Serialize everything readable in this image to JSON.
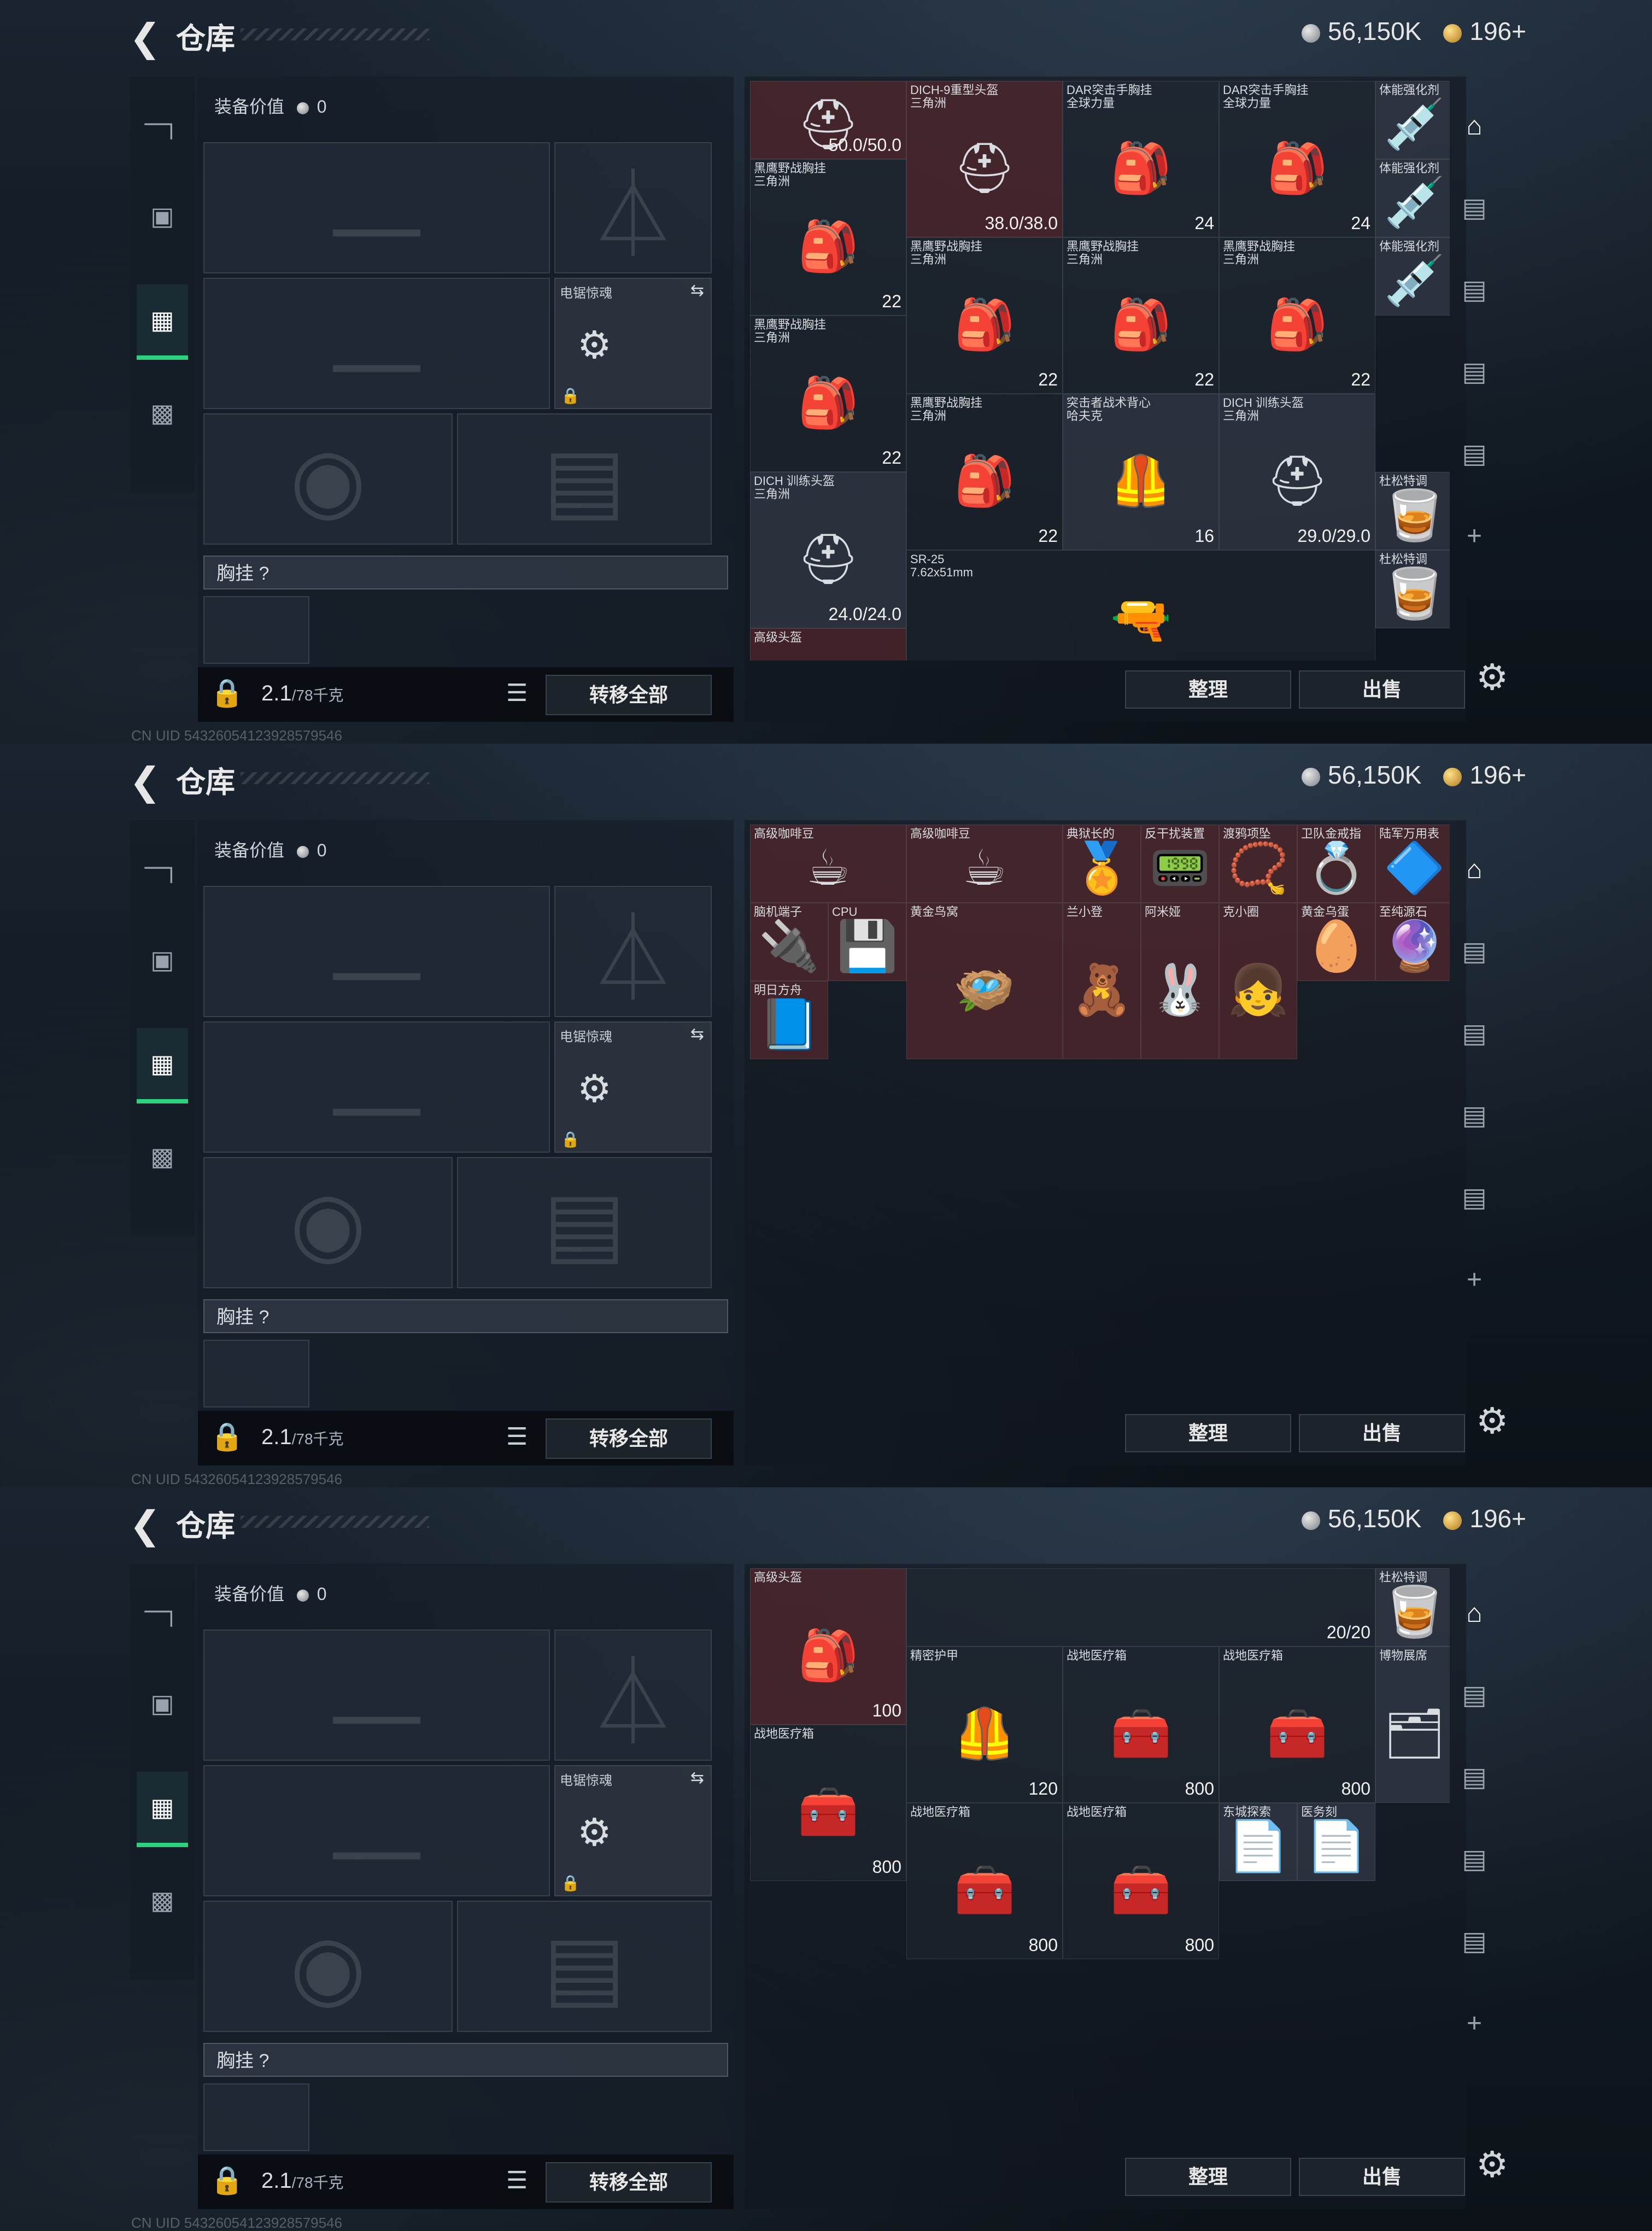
{
  "header": {
    "title": "仓库",
    "silver_amount": "56,150K",
    "gold_amount": "196+"
  },
  "equip": {
    "value_label": "装备价值",
    "value": "0",
    "melee_label": "电锯惊魂",
    "chest_label": "胸挂 ?",
    "weight": "2.1",
    "weight_max": "/78千克",
    "transfer_all": "转移全部"
  },
  "actions": {
    "sort": "整理",
    "sell": "出售"
  },
  "footer": "CN UID 5432605412392857954​6",
  "frames": [
    {
      "cells": [
        {
          "name": "",
          "count": "50.0/50.0",
          "style": "red",
          "icon": "⛑"
        },
        {
          "name": "DICH-9重型头盔\n三角洲",
          "count": "38.0/38.0",
          "style": "red",
          "icon": "⛑"
        },
        {
          "name": "DAR突击手胸挂\n全球力量",
          "count": "24",
          "style": "",
          "icon": "🎒"
        },
        {
          "name": "DAR突击手胸挂\n全球力量",
          "count": "24",
          "style": "",
          "icon": "🎒"
        },
        {
          "name": "体能强化剂",
          "count": "",
          "style": "dark",
          "icon": "💉"
        },
        {
          "name": "黑鹰野战胸挂\n三角洲",
          "count": "22",
          "style": "",
          "icon": "🎒"
        },
        {
          "name": "黑鹰野战胸挂\n三角洲",
          "count": "22",
          "style": "",
          "icon": "🎒"
        },
        {
          "name": "黑鹰野战胸挂\n三角洲",
          "count": "22",
          "style": "",
          "icon": "🎒"
        },
        {
          "name": "黑鹰野战胸挂\n三角洲",
          "count": "22",
          "style": "",
          "icon": "🎒"
        },
        {
          "name": "体能强化剂",
          "count": "",
          "style": "dark",
          "icon": "💉"
        },
        {
          "name": "黑鹰野战胸挂\n三角洲",
          "count": "22",
          "style": "",
          "icon": "🎒"
        },
        {
          "name": "黑鹰野战胸挂\n三角洲",
          "count": "22",
          "style": "",
          "icon": "🎒"
        },
        {
          "name": "突击者战术背心\n哈夫克",
          "count": "16",
          "style": "dark",
          "icon": "🦺"
        },
        {
          "name": "DICH 训练头盔\n三角洲",
          "count": "29.0/29.0",
          "style": "dark",
          "icon": "⛑"
        },
        {
          "name": "体能强化剂",
          "count": "",
          "style": "dark",
          "icon": "💉"
        },
        {
          "name": "DICH 训练头盔\n三角洲",
          "count": "24.0/24.0",
          "style": "dark",
          "icon": "⛑"
        },
        {
          "name": "SR-25\n7.62x51mm",
          "count": "",
          "style": "",
          "icon": "🔫"
        },
        {
          "name": "杜松特调",
          "count": "",
          "style": "dark",
          "icon": "🥃"
        },
        {
          "name": "高级头盔",
          "count": "",
          "style": "red",
          "icon": ""
        },
        {
          "name": "杜松特调",
          "count": "",
          "style": "dark",
          "icon": "🥃"
        }
      ]
    },
    {
      "cells": [
        {
          "name": "高级咖啡豆",
          "count": "",
          "style": "red",
          "icon": "☕"
        },
        {
          "name": "高级咖啡豆",
          "count": "",
          "style": "red",
          "icon": "☕"
        },
        {
          "name": "典狱长的",
          "count": "",
          "style": "red",
          "icon": "🏅"
        },
        {
          "name": "反干扰装置",
          "count": "",
          "style": "red",
          "icon": "📟"
        },
        {
          "name": "渡鸦项坠",
          "count": "",
          "style": "red",
          "icon": "📿"
        },
        {
          "name": "卫队金戒指",
          "count": "",
          "style": "red",
          "icon": "💍"
        },
        {
          "name": "陆军万用表",
          "count": "",
          "style": "red",
          "icon": "🔷"
        },
        {
          "name": "脑机端子",
          "count": "",
          "style": "red",
          "icon": "🔌"
        },
        {
          "name": "CPU",
          "count": "",
          "style": "red",
          "icon": "💾"
        },
        {
          "name": "黄金鸟窝",
          "count": "",
          "style": "red",
          "icon": "🪺"
        },
        {
          "name": "兰小登",
          "count": "",
          "style": "red",
          "icon": "🧸"
        },
        {
          "name": "阿米娅",
          "count": "",
          "style": "red",
          "icon": "🐰"
        },
        {
          "name": "克小圈",
          "count": "",
          "style": "red",
          "icon": "👧"
        },
        {
          "name": "黄金乌蛋",
          "count": "",
          "style": "red",
          "icon": "🥚"
        },
        {
          "name": "至纯源石",
          "count": "",
          "style": "red",
          "icon": "🔮"
        },
        {
          "name": "明日方舟",
          "count": "",
          "style": "red",
          "icon": "📘"
        }
      ]
    },
    {
      "cells": [
        {
          "name": "高级头盔",
          "count": "100",
          "style": "red",
          "icon": "🎒"
        },
        {
          "name": "",
          "count": "20/20",
          "style": "",
          "icon": ""
        },
        {
          "name": "杜松特调",
          "count": "",
          "style": "dark",
          "icon": "🥃"
        },
        {
          "name": "精密护甲",
          "count": "120",
          "style": "",
          "icon": "🦺"
        },
        {
          "name": "战地医疗箱",
          "count": "800",
          "style": "",
          "icon": "🧰"
        },
        {
          "name": "战地医疗箱",
          "count": "800",
          "style": "",
          "icon": "🧰"
        },
        {
          "name": "博物展席",
          "count": "",
          "style": "dark",
          "icon": "🗂"
        },
        {
          "name": "战地医疗箱",
          "count": "800",
          "style": "",
          "icon": "🧰"
        },
        {
          "name": "战地医疗箱",
          "count": "800",
          "style": "",
          "icon": "🧰"
        },
        {
          "name": "战地医疗箱",
          "count": "800",
          "style": "",
          "icon": "🧰"
        },
        {
          "name": "东城探索",
          "count": "",
          "style": "dark",
          "icon": "📄"
        },
        {
          "name": "医务刻",
          "count": "",
          "style": "dark",
          "icon": "📄"
        }
      ]
    }
  ]
}
